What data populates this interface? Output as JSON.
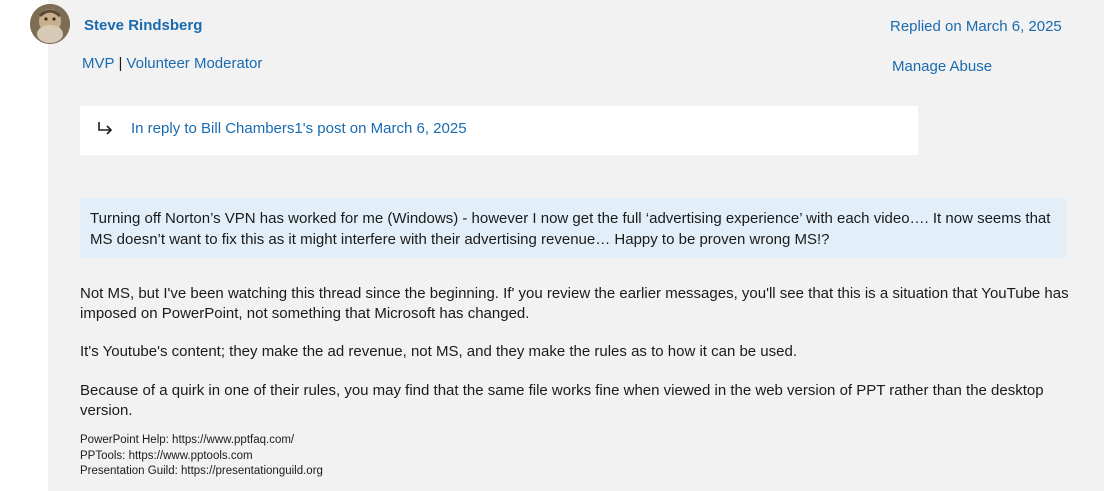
{
  "author": {
    "name": "Steve Rindsberg",
    "role_mvp": "MVP",
    "role_separator": "|",
    "role_moderator": "Volunteer Moderator"
  },
  "post_meta": {
    "replied": "Replied on March 6, 2025",
    "manage_abuse": "Manage Abuse"
  },
  "reply_to": {
    "text": "In reply to Bill Chambers1's post on March 6, 2025"
  },
  "quote": {
    "text": "Turning off Norton’s VPN has worked for me (Windows) - however I now get the full ‘advertising experience’ with each video…. It now seems that MS doesn’t want to fix this as it might interfere with their advertising revenue… Happy to be proven wrong MS!?"
  },
  "body": {
    "p1": "Not MS, but I've been watching this thread since the beginning. If' you review the earlier messages, you'll see that this is a situation that YouTube has imposed on PowerPoint, not something that Microsoft has changed.",
    "p2": "It's Youtube's content; they make the ad revenue, not MS, and they make the rules as to how it can be used.",
    "p3": "Because of a quirk in one of their rules, you may find that the same file works fine when viewed in the web version of PPT rather than the desktop version."
  },
  "signature": {
    "line1": "PowerPoint Help: https://www.pptfaq.com/",
    "line2": "PPTools: https://www.pptools.com",
    "line3": "Presentation Guild: https://presentationguild.org"
  },
  "colors": {
    "link": "#1a6ab0",
    "panel_bg": "#f2f2f2",
    "quote_bg": "#e2eff8"
  },
  "icons": {
    "avatar": "avatar",
    "reply": "reply-arrow-icon"
  }
}
